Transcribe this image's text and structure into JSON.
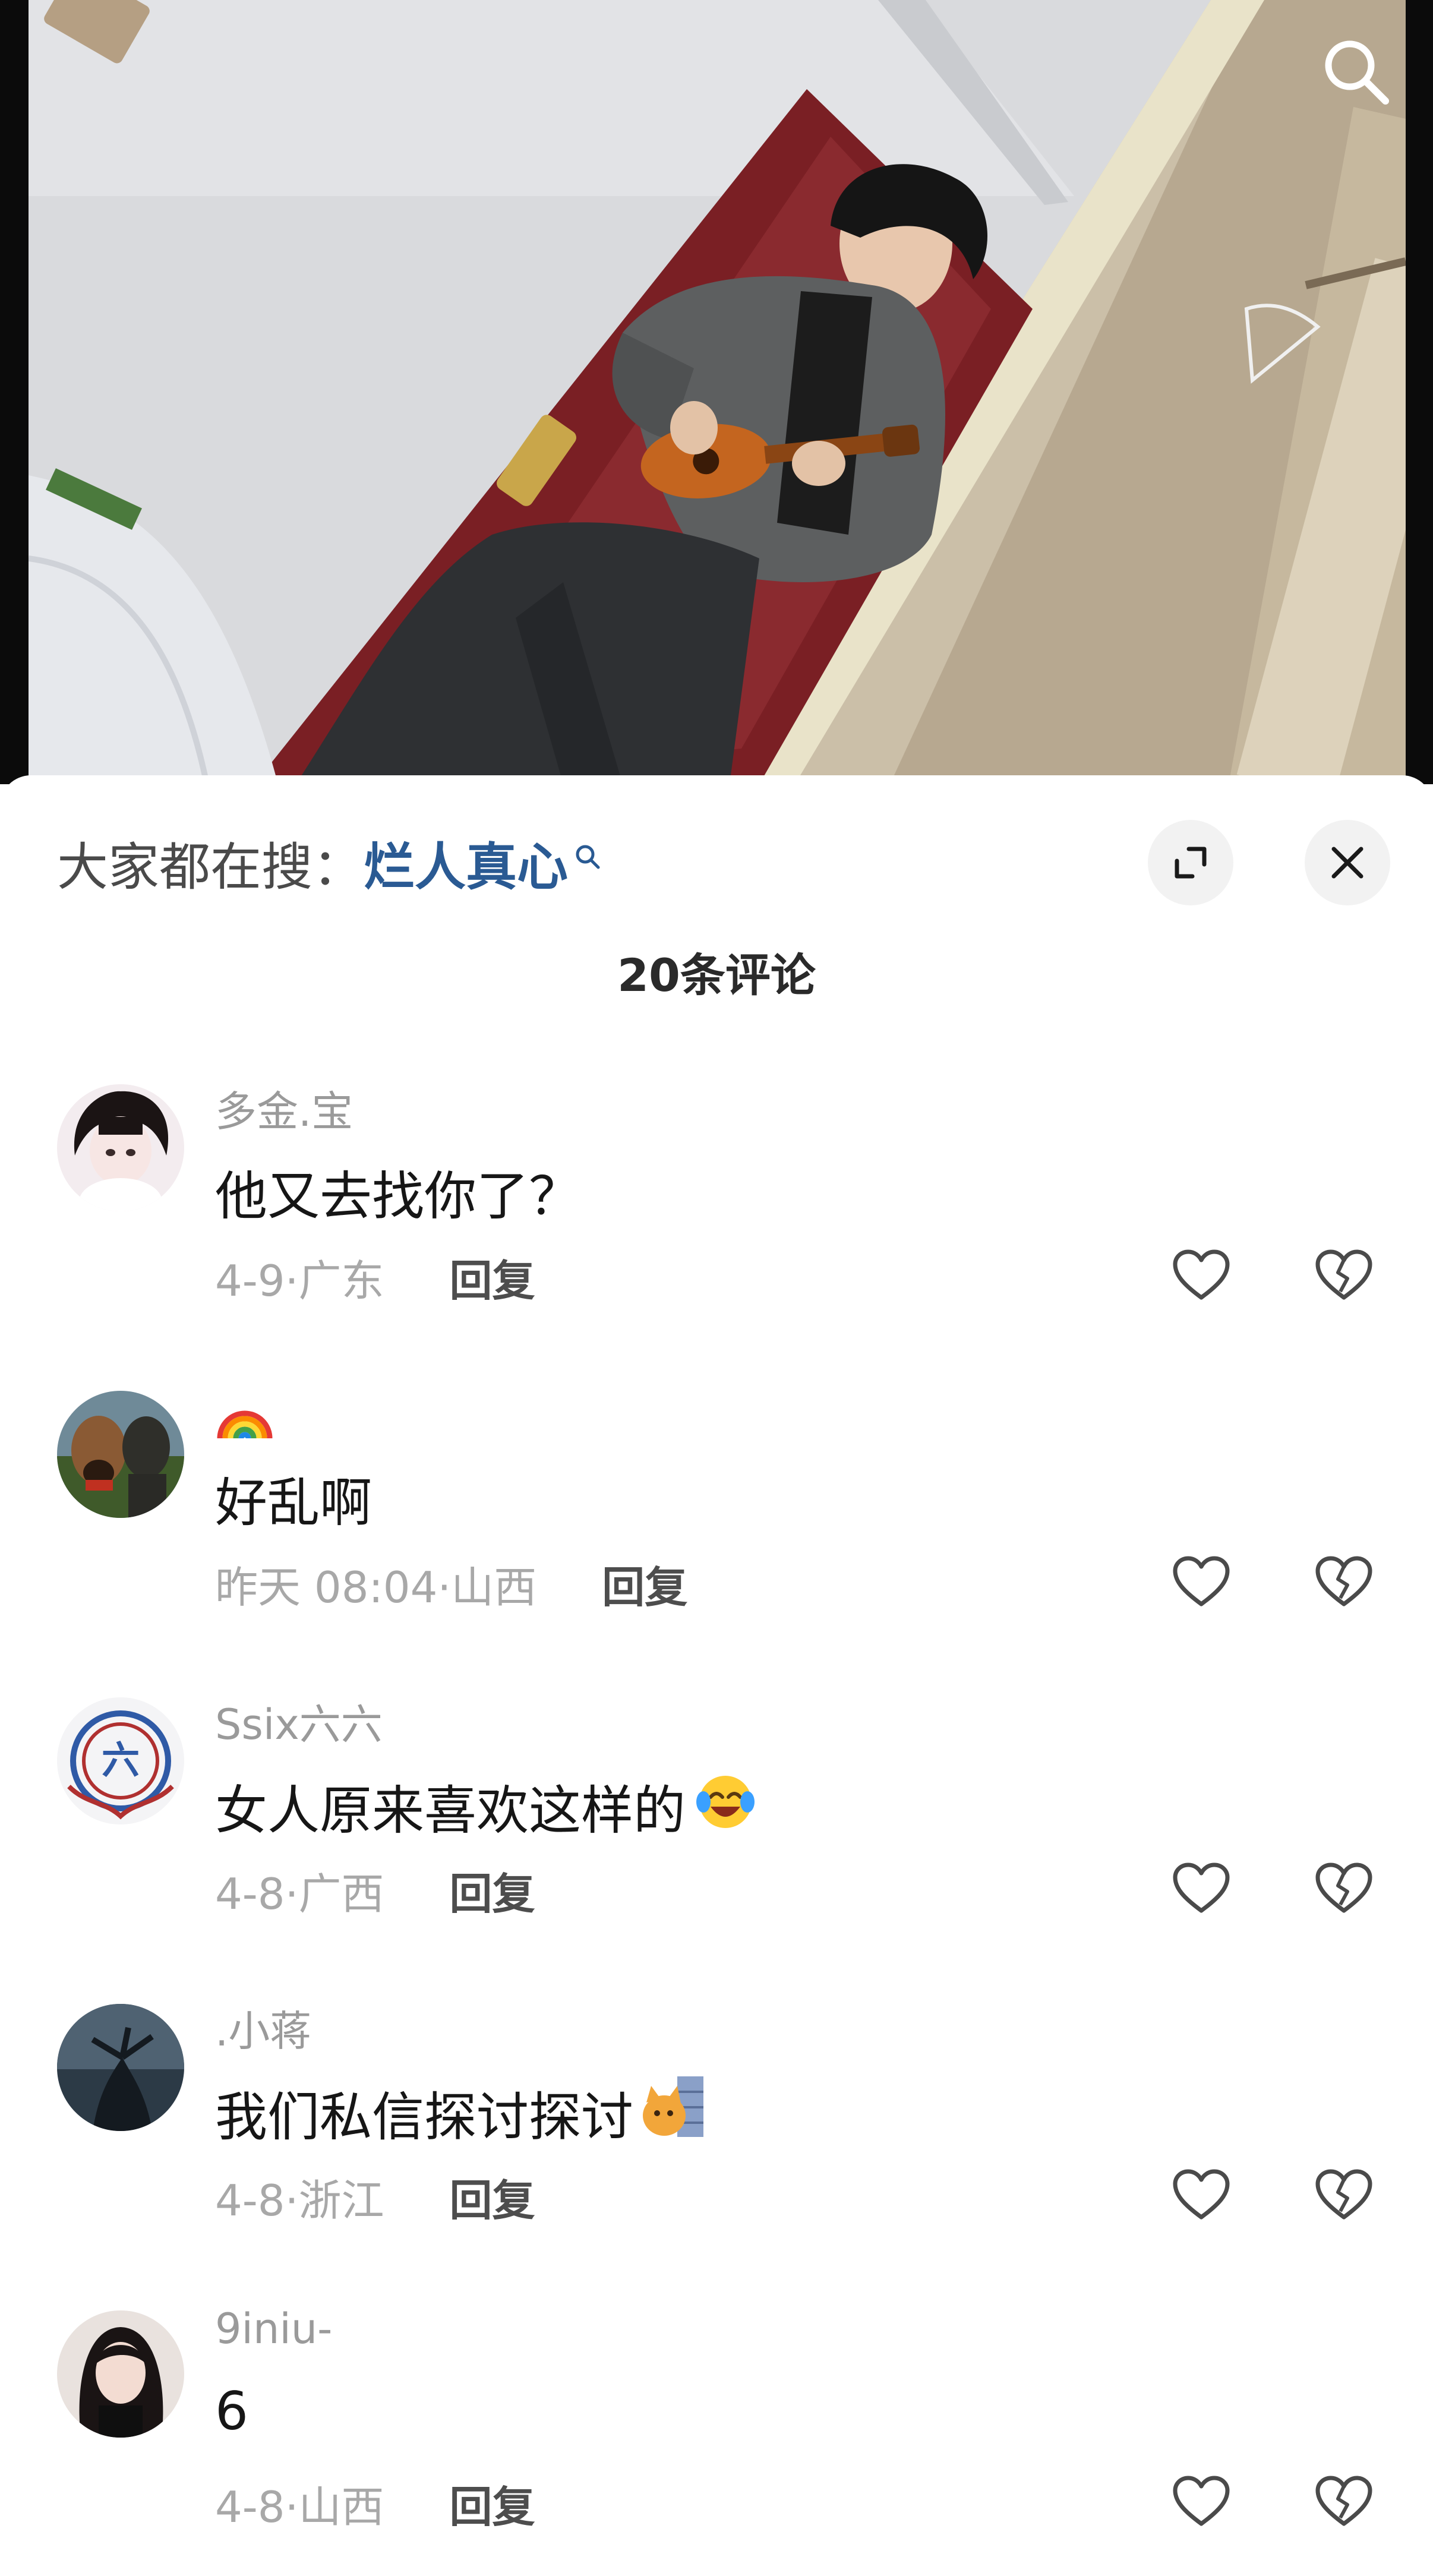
{
  "hot_search": {
    "label": "大家都在搜：",
    "term": "烂人真心"
  },
  "comment_count": "20条评论",
  "comments": [
    {
      "user": "多金.宝",
      "text": "他又去找你了？",
      "meta": "4-9·广东",
      "reply": "回复",
      "emoji": ""
    },
    {
      "user": "🌈",
      "text": "好乱啊",
      "meta": "昨天 08:04·山西",
      "reply": "回复",
      "emoji": ""
    },
    {
      "user": "Ssix六六",
      "text": "女人原来喜欢这样的",
      "meta": "4-8·广西",
      "reply": "回复",
      "emoji": "laughing-crying-emoji"
    },
    {
      "user": ".小蒋",
      "text": "我们私信探讨探讨",
      "meta": "4-8·浙江",
      "reply": "回复",
      "emoji": "cat-peeking-emoji"
    },
    {
      "user": "9iniu-",
      "text": "6",
      "meta": "4-8·山西",
      "reply": "回复",
      "emoji": ""
    }
  ]
}
